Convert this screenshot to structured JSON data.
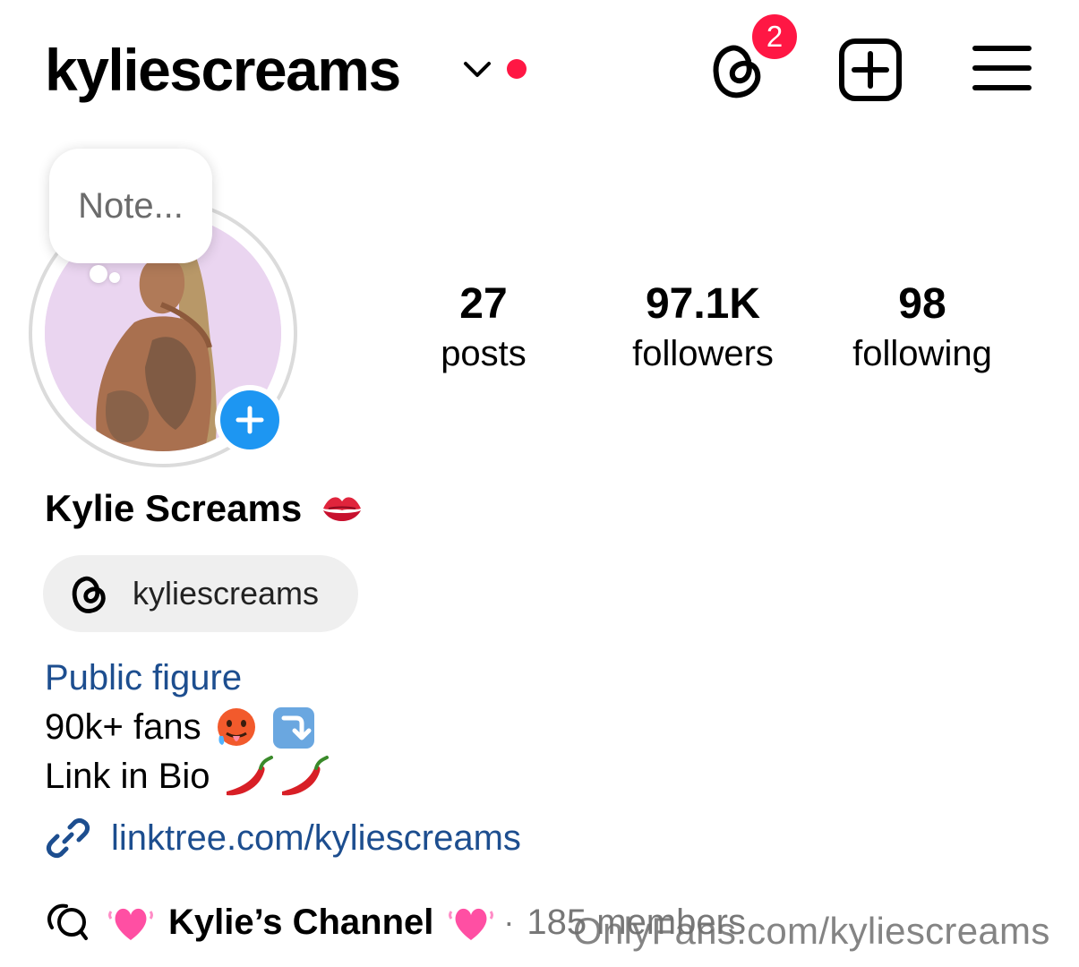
{
  "header": {
    "username": "kyliescreams",
    "threads_badge": "2"
  },
  "note": {
    "placeholder": "Note..."
  },
  "stats": [
    {
      "value": "27",
      "label": "posts"
    },
    {
      "value": "97.1K",
      "label": "followers"
    },
    {
      "value": "98",
      "label": "following"
    }
  ],
  "profile": {
    "display_name": "Kylie Screams",
    "threads_handle": "kyliescreams",
    "category": "Public figure",
    "bio_line1": "90k+ fans",
    "bio_line2": "Link in Bio",
    "link": "linktree.com/kyliescreams"
  },
  "channel": {
    "name": "Kylie’s Channel",
    "separator": "·",
    "members": "185 members"
  },
  "watermark": "OnlyFans.com/kyliescreams",
  "colors": {
    "accent_red": "#ff1744",
    "link_blue": "#1d4e8f",
    "story_blue": "#1d96f2",
    "pill_bg": "#efefef"
  }
}
